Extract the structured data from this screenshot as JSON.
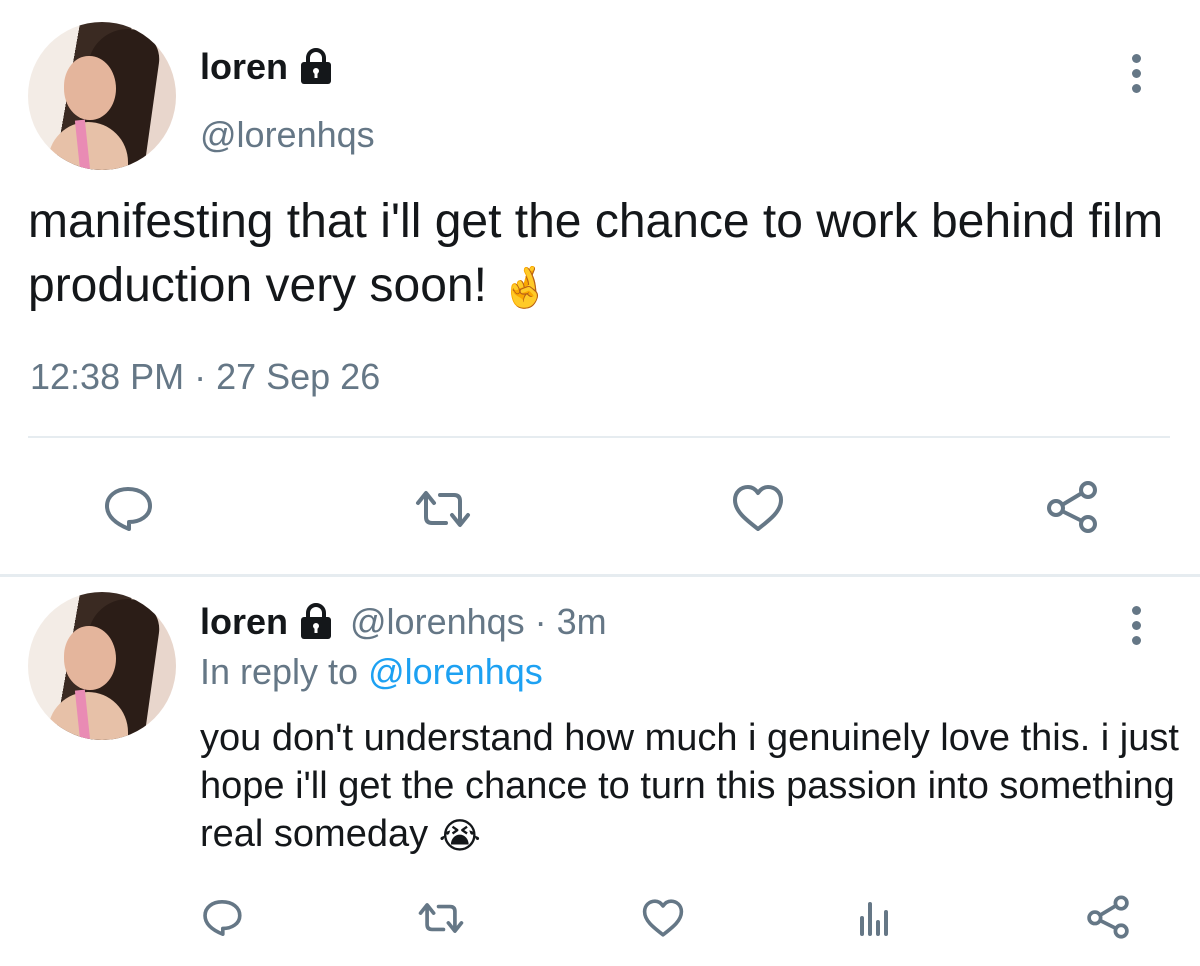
{
  "main_tweet": {
    "display_name": "loren",
    "handle": "@lorenhqs",
    "text": "manifesting that i'll get the chance to work behind film production very soon!",
    "emoji": "🤞",
    "timestamp": "12:38 PM · 27 Sep 26"
  },
  "reply_tweet": {
    "display_name": "loren",
    "handle_time": "@lorenhqs · 3m",
    "in_reply_prefix": "In reply to ",
    "in_reply_handle": "@lorenhqs",
    "text": "you don't understand how much i genuinely love this. i just hope i'll get the chance to turn this passion into something real someday",
    "emoji": "😭"
  },
  "icons": {
    "lock": "lock-icon",
    "more": "more-vertical-icon",
    "reply": "reply-icon",
    "retweet": "retweet-icon",
    "like": "heart-icon",
    "share": "share-icon",
    "analytics": "analytics-icon"
  },
  "colors": {
    "text": "#14171a",
    "secondary": "#657786",
    "link": "#1da1f2",
    "divider": "#e6ecf0"
  }
}
